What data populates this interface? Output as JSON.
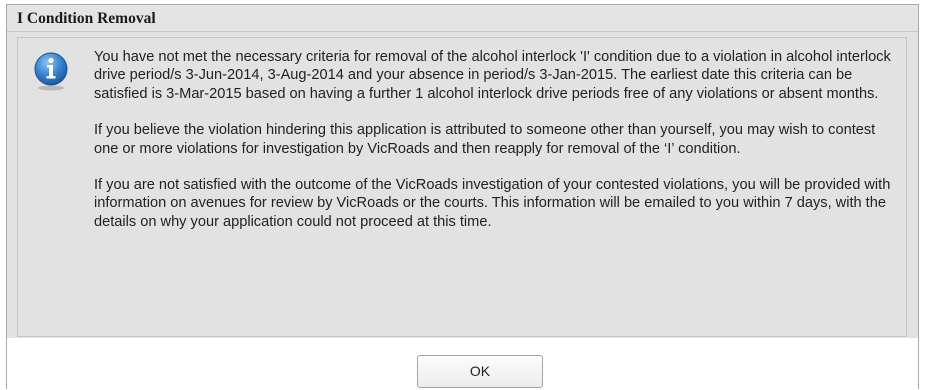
{
  "dialog": {
    "title": "I Condition Removal",
    "icon": "info-icon",
    "paragraphs": [
      "You have not met the necessary criteria for removal of the alcohol interlock 'I' condition due to a violation in alcohol interlock drive period/s 3-Jun-2014, 3-Aug-2014 and your absence in period/s 3-Jan-2015. The earliest date this criteria can be satisfied is 3-Mar-2015 based on having a further 1 alcohol interlock drive periods free of any violations or absent months.",
      "If you believe the violation hindering this application is attributed to someone other than yourself, you may wish to contest one or more violations for investigation by VicRoads and then reapply for removal of the ‘I’ condition.",
      "If you are not satisfied with the outcome of the VicRoads investigation of your contested violations, you will be provided with information on avenues for review by VicRoads or the courts. This information will be emailed to you within 7 days, with the details on why your application could not proceed at this time."
    ],
    "ok_label": "OK"
  }
}
